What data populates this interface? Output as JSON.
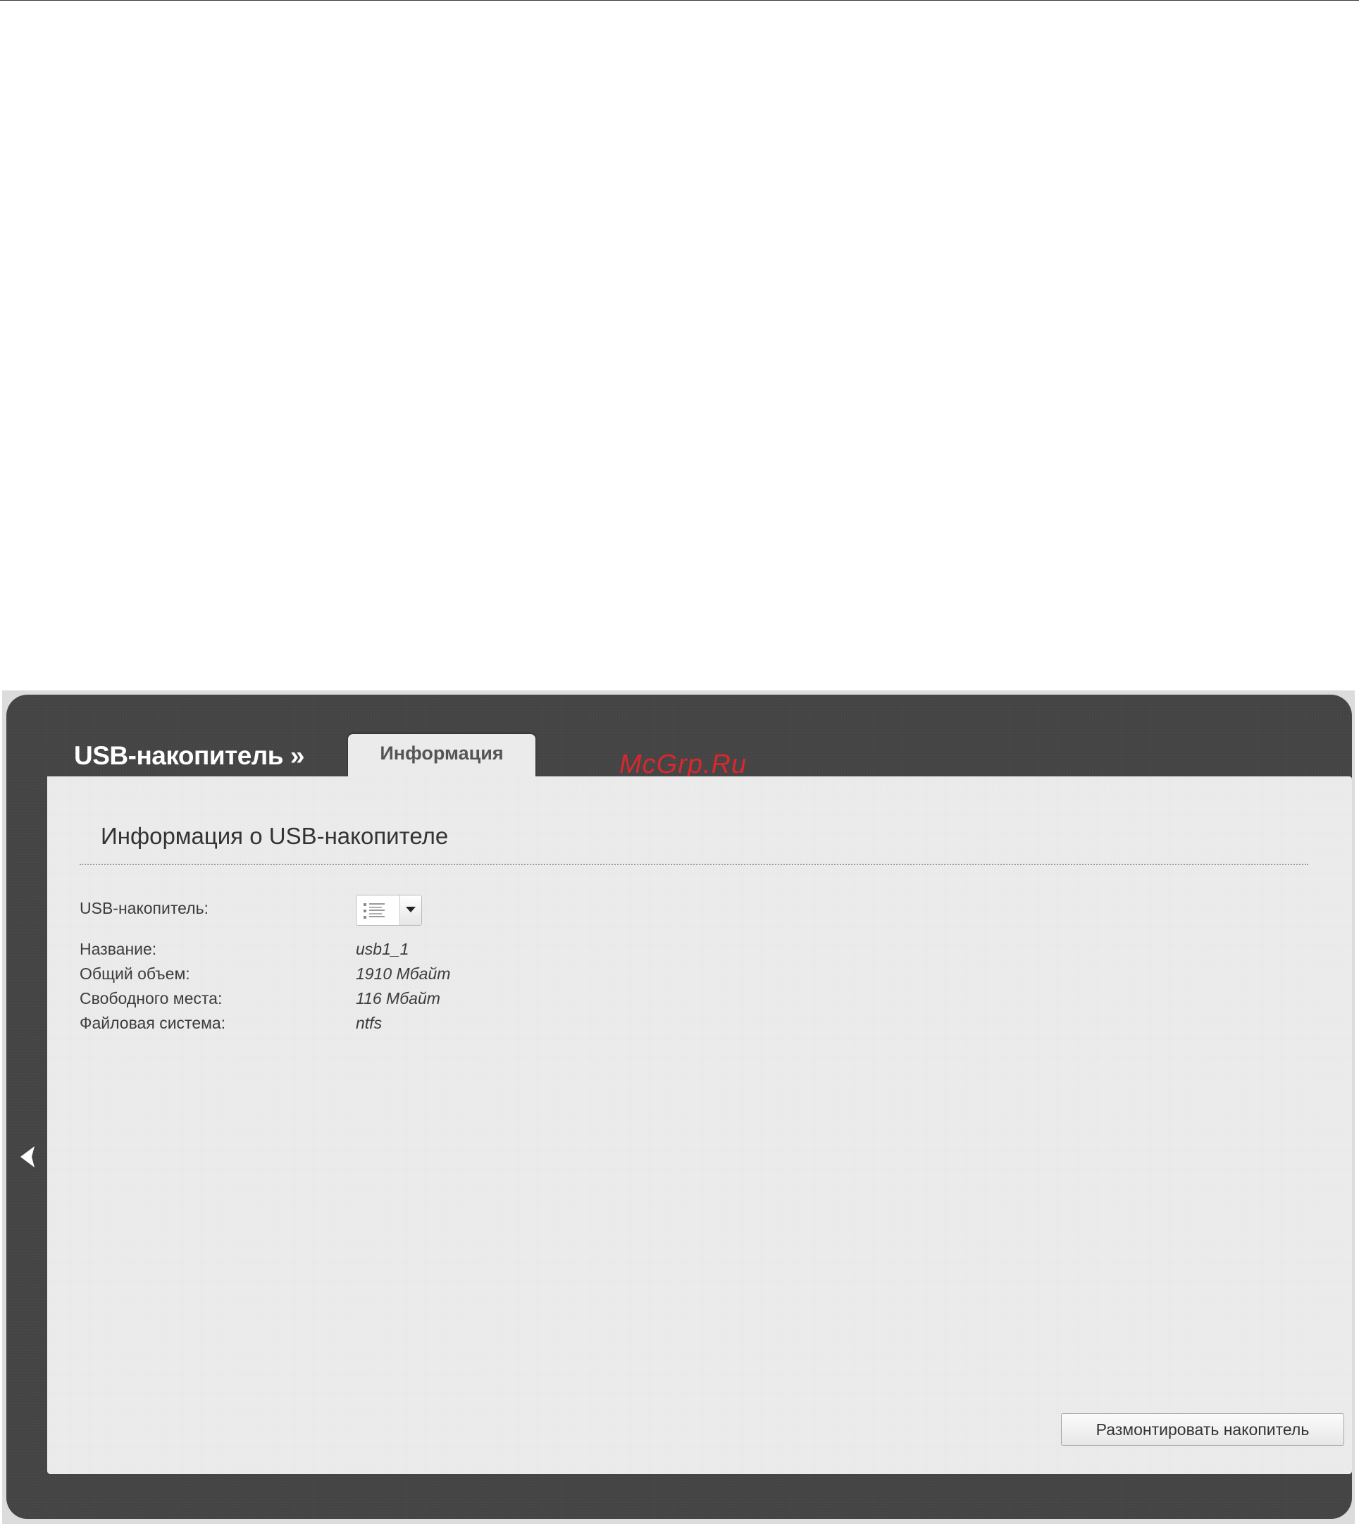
{
  "header": {
    "title": "USB-накопитель »",
    "tab_info": "Информация"
  },
  "watermark": "McGrp.Ru",
  "section": {
    "title": "Информация о USB-накопителе"
  },
  "fields": {
    "usb_label": "USB-накопитель:",
    "name_label": "Название:",
    "name_value": "usb1_1",
    "total_label": "Общий объем:",
    "total_value": "1910 Мбайт",
    "free_label": "Свободного места:",
    "free_value": "116 Мбайт",
    "fs_label": "Файловая система:",
    "fs_value": "ntfs"
  },
  "actions": {
    "unmount_label": "Размонтировать накопитель"
  },
  "icons": {
    "back": "chevron-left-icon",
    "select_list": "list-icon",
    "select_arrow": "caret-down-icon"
  },
  "colors": {
    "shell": "#444444",
    "panel": "#ececec",
    "watermark": "#d8282e"
  }
}
